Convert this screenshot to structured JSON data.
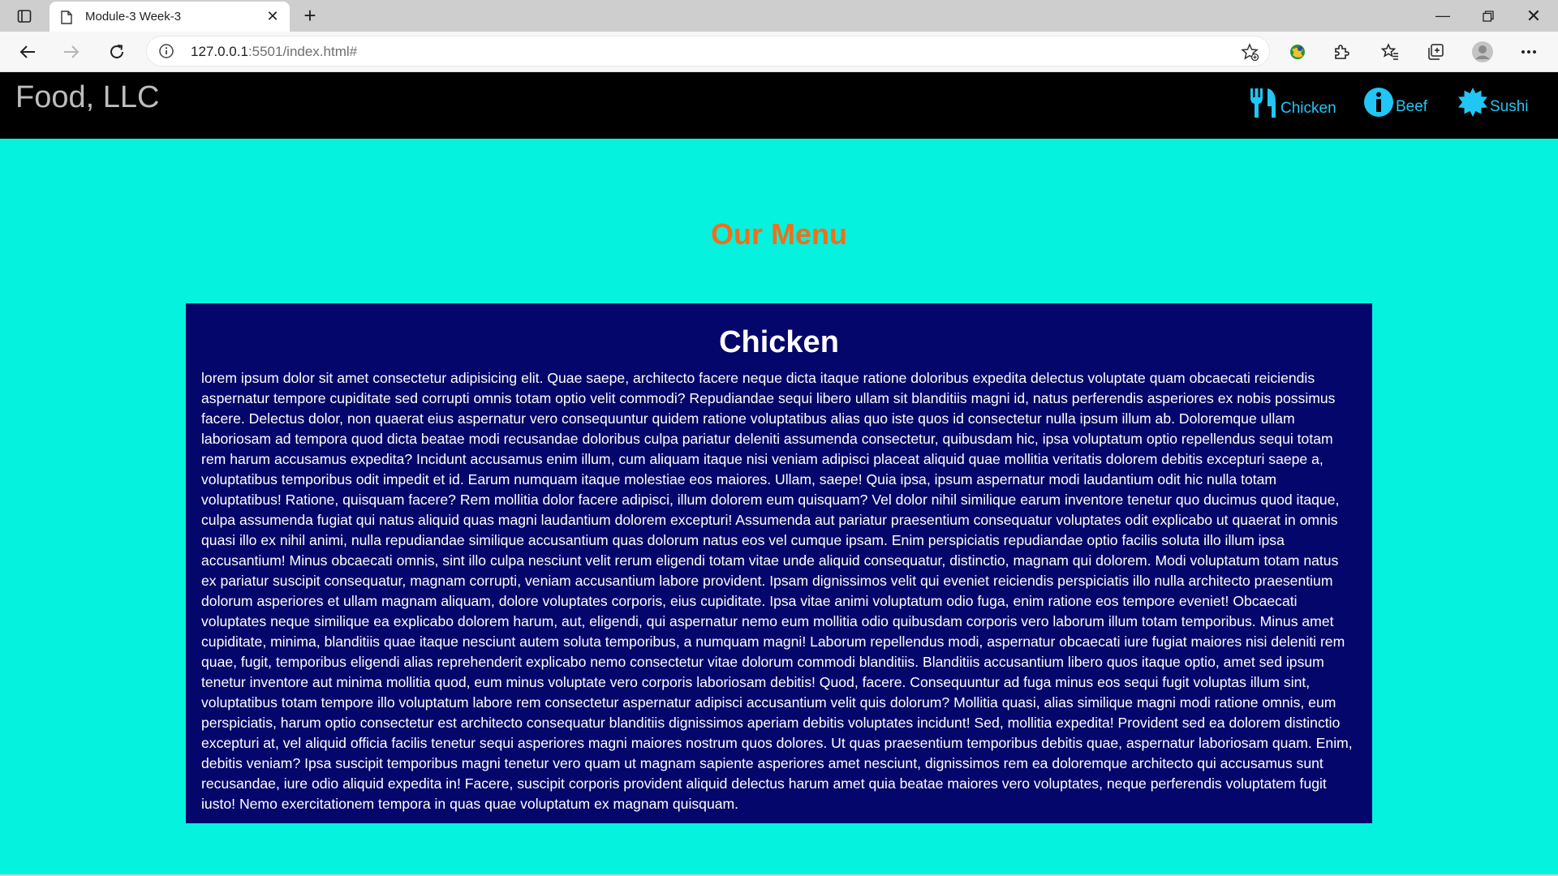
{
  "browser": {
    "tab_title": "Module-3 Week-3",
    "address_host": "127.0.0.1",
    "address_rest": ":5501/index.html#"
  },
  "site": {
    "brand": "Food, LLC",
    "nav": [
      {
        "label": "Chicken",
        "icon": "utensils-icon"
      },
      {
        "label": "Beef",
        "icon": "info-circle-icon"
      },
      {
        "label": "Sushi",
        "icon": "starburst-icon"
      }
    ],
    "menu_heading": "Our Menu",
    "section": {
      "title": "Chicken",
      "body": "lorem ipsum dolor sit amet consectetur adipisicing elit. Quae saepe, architecto facere neque dicta itaque ratione doloribus expedita delectus voluptate quam obcaecati reiciendis aspernatur tempore cupiditate sed corrupti omnis totam optio velit commodi? Repudiandae sequi libero ullam sit blanditiis magni id, natus perferendis asperiores ex nobis possimus facere. Delectus dolor, non quaerat eius aspernatur vero consequuntur quidem ratione voluptatibus alias quo iste quos id consectetur nulla ipsum illum ab. Doloremque ullam laboriosam ad tempora quod dicta beatae modi recusandae doloribus culpa pariatur deleniti assumenda consectetur, quibusdam hic, ipsa voluptatum optio repellendus sequi totam rem harum accusamus expedita? Incidunt accusamus enim illum, cum aliquam itaque nisi veniam adipisci placeat aliquid quae mollitia veritatis dolorem debitis excepturi saepe a, voluptatibus temporibus odit impedit et id. Earum numquam itaque molestiae eos maiores. Ullam, saepe! Quia ipsa, ipsum aspernatur modi laudantium odit hic nulla totam voluptatibus! Ratione, quisquam facere? Rem mollitia dolor facere adipisci, illum dolorem eum quisquam? Vel dolor nihil similique earum inventore tenetur quo ducimus quod itaque, culpa assumenda fugiat qui natus aliquid quas magni laudantium dolorem excepturi! Assumenda aut pariatur praesentium consequatur voluptates odit explicabo ut quaerat in omnis quasi illo ex nihil animi, nulla repudiandae similique accusantium quas dolorum natus eos vel cumque ipsam. Enim perspiciatis repudiandae optio facilis soluta illo illum ipsa accusantium! Minus obcaecati omnis, sint illo culpa nesciunt velit rerum eligendi totam vitae unde aliquid consequatur, distinctio, magnam qui dolorem. Modi voluptatum totam natus ex pariatur suscipit consequatur, magnam corrupti, veniam accusantium labore provident. Ipsam dignissimos velit qui eveniet reiciendis perspiciatis illo nulla architecto praesentium dolorum asperiores et ullam magnam aliquam, dolore voluptates corporis, eius cupiditate. Ipsa vitae animi voluptatum odio fuga, enim ratione eos tempore eveniet! Obcaecati voluptates neque similique ea explicabo dolorem harum, aut, eligendi, qui aspernatur nemo eum mollitia odio quibusdam corporis vero laborum illum totam temporibus. Minus amet cupiditate, minima, blanditiis quae itaque nesciunt autem soluta temporibus, a numquam magni! Laborum repellendus modi, aspernatur obcaecati iure fugiat maiores nisi deleniti rem quae, fugit, temporibus eligendi alias reprehenderit explicabo nemo consectetur vitae dolorum commodi blanditiis. Blanditiis accusantium libero quos itaque optio, amet sed ipsum tenetur inventore aut minima mollitia quod, eum minus voluptate vero corporis laboriosam debitis! Quod, facere. Consequuntur ad fuga minus eos sequi fugit voluptas illum sint, voluptatibus totam tempore illo voluptatum labore rem consectetur aspernatur adipisci accusantium velit quis dolorum? Mollitia quasi, alias similique magni modi ratione omnis, eum perspiciatis, harum optio consectetur est architecto consequatur blanditiis dignissimos aperiam debitis voluptates incidunt! Sed, mollitia expedita! Provident sed ea dolorem distinctio excepturi at, vel aliquid officia facilis tenetur sequi asperiores magni maiores nostrum quos dolores. Ut quas praesentium temporibus debitis quae, aspernatur laboriosam quam. Enim, debitis veniam? Ipsa suscipit temporibus magni tenetur vero quam ut magnam sapiente asperiores amet nesciunt, dignissimos rem ea doloremque architecto qui accusamus sunt recusandae, iure odio aliquid expedita in! Facere, suscipit corporis provident aliquid delectus harum amet quia beatae maiores vero voluptates, neque perferendis voluptatem fugit iusto! Nemo exercitationem tempora in quas quae voluptatum ex magnam quisquam."
    }
  },
  "colors": {
    "page_bg": "#04f2de",
    "header_bg": "#000000",
    "brand_text": "#bdbdbd",
    "nav_link": "#21c6f4",
    "menu_heading": "#ef6f1b",
    "panel_bg": "#05066b"
  }
}
